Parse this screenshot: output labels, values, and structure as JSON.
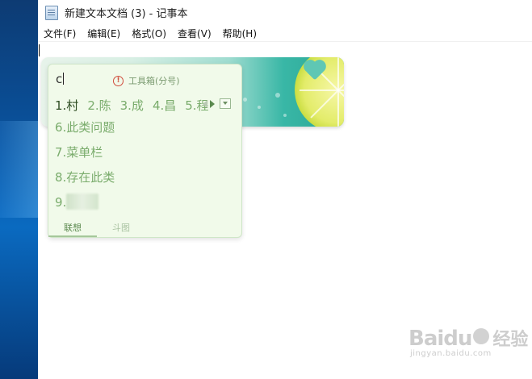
{
  "window": {
    "title": "新建文本文档 (3) - 记事本",
    "menu": [
      "文件(F)",
      "编辑(E)",
      "格式(O)",
      "查看(V)",
      "帮助(H)"
    ]
  },
  "ime": {
    "input": "c",
    "toolbox_label": "工具箱(分号)",
    "candidates": [
      "1.村",
      "2.陈",
      "3.成",
      "4.昌",
      "5.程"
    ],
    "list": [
      "6.此类问题",
      "7.菜单栏",
      "8.存在此类",
      "9."
    ],
    "tabs": [
      "联想",
      "斗图"
    ],
    "colors": {
      "panel": "#f1faea",
      "active_text": "#2e4d22",
      "candidate_text": "#7aac6c",
      "accent": "#39b7a6"
    }
  },
  "watermark": {
    "logo": "Baidu",
    "cn": "经验",
    "sub": "jingyan.baidu.com"
  }
}
